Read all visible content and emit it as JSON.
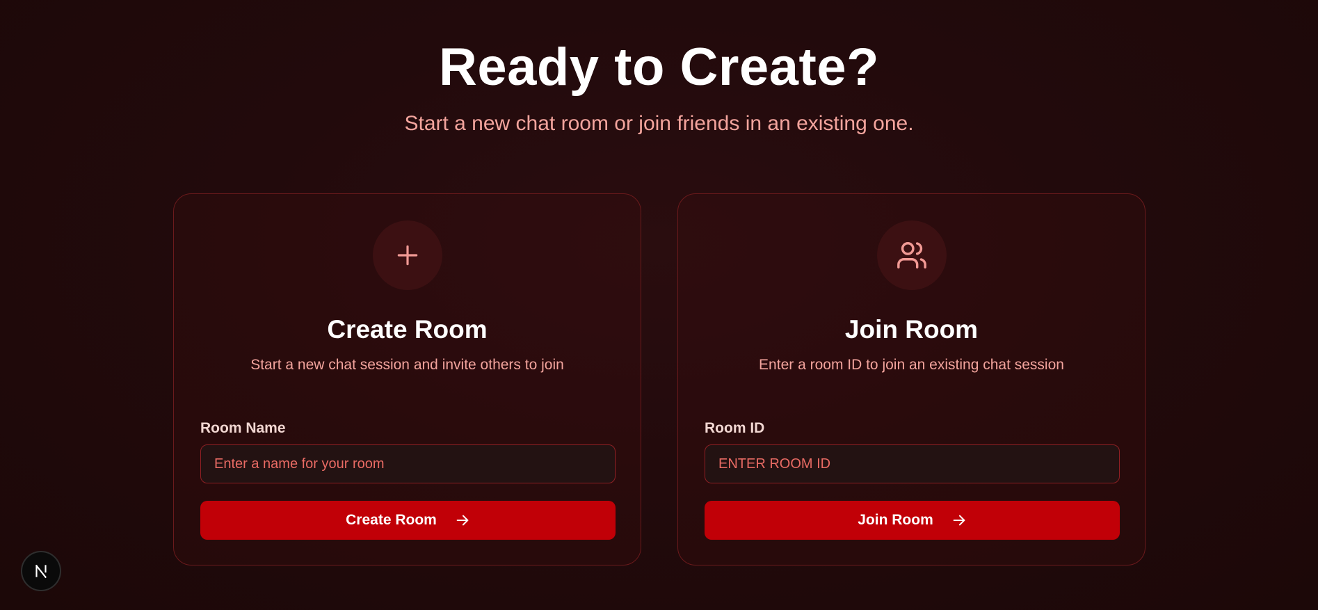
{
  "hero": {
    "title": "Ready to Create?",
    "subtitle": "Start a new chat room or join friends in an existing one."
  },
  "create_card": {
    "icon": "plus-icon",
    "title": "Create Room",
    "description": "Start a new chat session and invite others to join",
    "field_label": "Room Name",
    "field_placeholder": "Enter a name for your room",
    "button_label": "Create Room",
    "button_icon": "arrow-right-icon"
  },
  "join_card": {
    "icon": "users-icon",
    "title": "Join Room",
    "description": "Enter a room ID to join an existing chat session",
    "field_label": "Room ID",
    "field_placeholder": "ENTER ROOM ID",
    "button_label": "Join Room",
    "button_icon": "arrow-right-icon"
  },
  "dev_badge": {
    "icon": "nextjs-logo-icon"
  },
  "colors": {
    "background": "#220a0c",
    "accent": "#c10007",
    "muted_text": "#f3a49d",
    "card_border": "#6b1a1c",
    "icon_circle": "#3c1012",
    "icon_stroke": "#f29a95"
  }
}
